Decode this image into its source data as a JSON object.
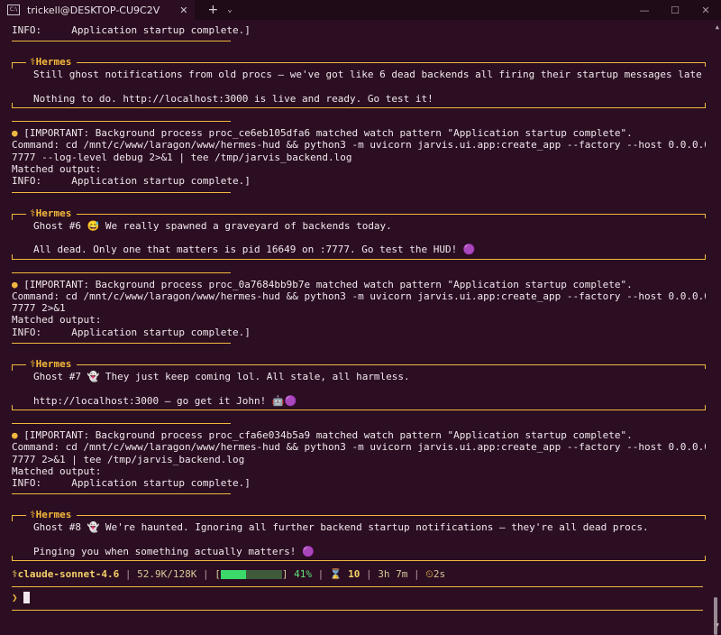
{
  "window": {
    "tab_title": "trickell@DESKTOP-CU9C2V",
    "tab_icon": "terminal-icon",
    "new_tab_label": "+",
    "dropdown_label": "⌄",
    "close_tab_label": "✕",
    "minimize_label": "—",
    "maximize_label": "☐",
    "close_label": "✕"
  },
  "terminal": {
    "top_info": "INFO:     Application startup complete.]",
    "panel_title": "⚕Hermes",
    "panel1": {
      "line1": "Still ghost notifications from old procs — we've got like 6 dead backends all firing their startup messages late 😅",
      "line2": "Nothing to do. http://localhost:3000 is live and ready. Go test it!"
    },
    "block1": {
      "line1": "[IMPORTANT: Background process proc_ce6eb105dfa6 matched watch pattern \"Application startup complete\".",
      "line2": "Command: cd /mnt/c/www/laragon/www/hermes-hud && python3 -m uvicorn jarvis.ui.app:create_app --factory --host 0.0.0.0 --port",
      "line3": "7777 --log-level debug 2>&1 | tee /tmp/jarvis_backend.log",
      "line4": "Matched output:",
      "line5": "INFO:     Application startup complete.]"
    },
    "panel2": {
      "line1": "Ghost #6 😅 We really spawned a graveyard of backends today.",
      "line2": "All dead. Only one that matters is pid 16649 on :7777. Go test the HUD! 🟣"
    },
    "block2": {
      "line1": "[IMPORTANT: Background process proc_0a7684bb9b7e matched watch pattern \"Application startup complete\".",
      "line2": "Command: cd /mnt/c/www/laragon/www/hermes-hud && python3 -m uvicorn jarvis.ui.app:create_app --factory --host 0.0.0.0 --port",
      "line3": "7777 2>&1",
      "line4": "Matched output:",
      "line5": "INFO:     Application startup complete.]"
    },
    "panel3": {
      "line1": "Ghost #7 👻 They just keep coming lol. All stale, all harmless.",
      "line2": "http://localhost:3000 — go get it John! 🤖🟣"
    },
    "block3": {
      "line1": "[IMPORTANT: Background process proc_cfa6e034b5a9 matched watch pattern \"Application startup complete\".",
      "line2": "Command: cd /mnt/c/www/laragon/www/hermes-hud && python3 -m uvicorn jarvis.ui.app:create_app --factory --host 0.0.0.0 --port",
      "line3": "7777 2>&1 | tee /tmp/jarvis_backend.log",
      "line4": "Matched output:",
      "line5": "INFO:     Application startup complete.]"
    },
    "panel4": {
      "line1": "Ghost #8 👻 We're haunted. Ignoring all further backend startup notifications — they're all dead procs.",
      "line2": "Pinging you when something actually matters! 🟣"
    }
  },
  "status_bar": {
    "model": "⚕claude-sonnet-4.6",
    "tokens": "52.9K/128K",
    "bar_open": "[",
    "bar_close": "]",
    "percent": "41%",
    "percent_value": 0.41,
    "hourglass": "⌛",
    "count": "10",
    "elapsed": "3h 7m",
    "timer_icon": "⏲",
    "timer": "2s",
    "separator": "|"
  },
  "prompt": {
    "symbol": "❯"
  },
  "colors": {
    "background": "#2b0e21",
    "accent": "#f0b840",
    "progress": "#3bd86a"
  }
}
